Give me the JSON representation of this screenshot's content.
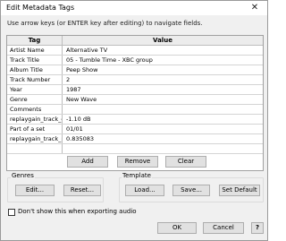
{
  "window": {
    "title": "Edit Metadata Tags",
    "close_icon": "close-icon"
  },
  "instructions": "Use arrow keys (or ENTER key after editing) to navigate fields.",
  "grid": {
    "headers": {
      "tag": "Tag",
      "value": "Value"
    },
    "rows": [
      {
        "tag": "Artist Name",
        "value": "Alternative TV"
      },
      {
        "tag": "Track Title",
        "value": "05 - Tumble Time - XBC group"
      },
      {
        "tag": "Album Title",
        "value": "Peep Show"
      },
      {
        "tag": "Track Number",
        "value": "2"
      },
      {
        "tag": "Year",
        "value": "1987"
      },
      {
        "tag": "Genre",
        "value": "New Wave"
      },
      {
        "tag": "Comments",
        "value": ""
      },
      {
        "tag": "replaygain_track_gai",
        "value": "-1.10 dB"
      },
      {
        "tag": "Part of a set",
        "value": "01/01"
      },
      {
        "tag": "replaygain_track_pe",
        "value": "0.835083"
      },
      {
        "tag": "",
        "value": ""
      }
    ]
  },
  "row_buttons": {
    "add": "Add",
    "remove": "Remove",
    "clear": "Clear"
  },
  "genres": {
    "label": "Genres",
    "edit": "Edit...",
    "reset": "Reset..."
  },
  "template": {
    "label": "Template",
    "load": "Load...",
    "save": "Save...",
    "set_default": "Set Default"
  },
  "options": {
    "dont_show_label": "Don't show this when exporting audio",
    "dont_show_checked": false
  },
  "dialog_buttons": {
    "ok": "OK",
    "cancel": "Cancel",
    "help_icon": "help-icon",
    "help_label": "?"
  }
}
